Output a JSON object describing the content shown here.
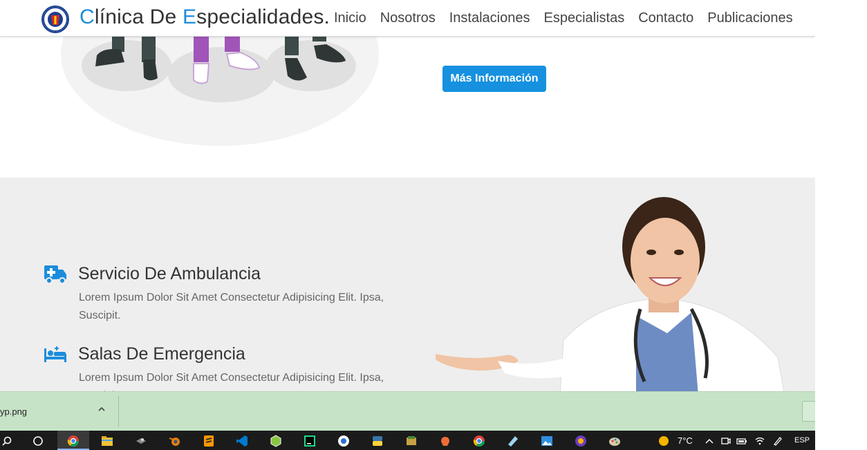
{
  "header": {
    "brand_first_letter": "C",
    "brand_part1": "línica De ",
    "brand_second_letter": "E",
    "brand_part2": "specialidades.",
    "nav": [
      "Inicio",
      "Nosotros",
      "Instalaciones",
      "Especialistas",
      "Contacto",
      "Publicaciones"
    ]
  },
  "hero": {
    "more_button": "Más Información"
  },
  "services": [
    {
      "icon": "ambulance-icon",
      "title": "Servicio De Ambulancia",
      "description": "Lorem Ipsum Dolor Sit Amet Consectetur Adipisicing Elit. Ipsa, Suscipit."
    },
    {
      "icon": "hospital-bed-icon",
      "title": "Salas De Emergencia",
      "description": "Lorem Ipsum Dolor Sit Amet Consectetur Adipisicing Elit. Ipsa, Suscipit."
    }
  ],
  "download_bar": {
    "file_name": "yp.png"
  },
  "taskbar": {
    "weather": "7°C",
    "language": "ESP"
  },
  "colors": {
    "accent": "#1c8ddb",
    "button": "#1591e0",
    "section_bg": "#eeeeee",
    "download_bar": "#c7e3c7",
    "taskbar": "#1b1b1b"
  }
}
